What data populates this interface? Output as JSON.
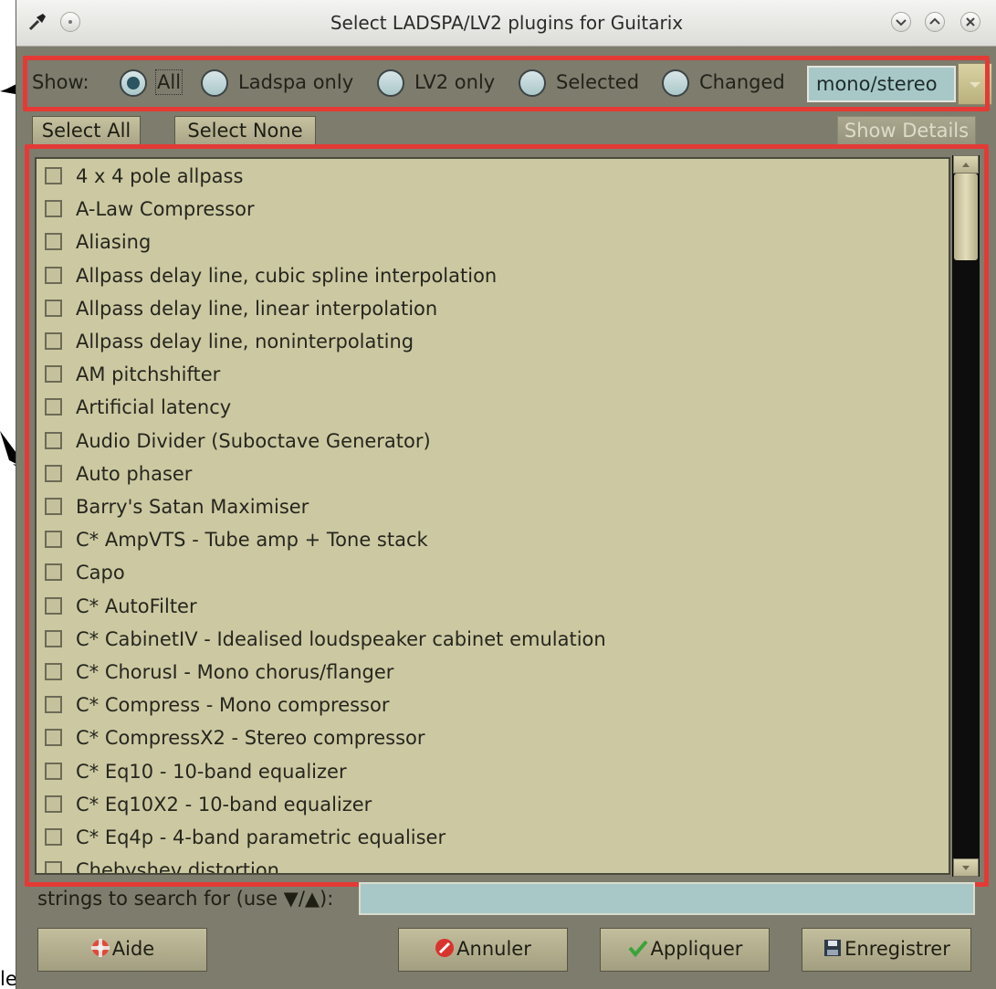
{
  "window": {
    "title": "Select LADSPA/LV2 plugins for Guitarix"
  },
  "show": {
    "label": "Show:",
    "options": [
      {
        "label": "All",
        "checked": true
      },
      {
        "label": "Ladspa only",
        "checked": false
      },
      {
        "label": "LV2 only",
        "checked": false
      },
      {
        "label": "Selected",
        "checked": false
      },
      {
        "label": "Changed",
        "checked": false
      }
    ],
    "channel_combo_value": "mono/stereo"
  },
  "buttons": {
    "select_all": "Select All",
    "select_none": "Select None",
    "show_details": "Show Details"
  },
  "plugins": [
    "4 x 4 pole allpass",
    "A-Law Compressor",
    "Aliasing",
    "Allpass delay line, cubic spline interpolation",
    "Allpass delay line, linear interpolation",
    "Allpass delay line, noninterpolating",
    "AM pitchshifter",
    "Artificial latency",
    "Audio Divider (Suboctave Generator)",
    "Auto phaser",
    "Barry's Satan Maximiser",
    "C* AmpVTS - Tube amp + Tone stack",
    "Capo",
    "C* AutoFilter",
    "C* CabinetIV - Idealised loudspeaker cabinet emulation",
    "C* ChorusI - Mono chorus/flanger",
    "C* Compress - Mono compressor",
    "C* CompressX2 - Stereo compressor",
    "C* Eq10 - 10-band equalizer",
    "C* Eq10X2 - 10-band equalizer",
    "C* Eq4p - 4-band parametric equaliser",
    "Chebyshev distortion"
  ],
  "search": {
    "label": "strings to search for (use ▼/▲):",
    "value": ""
  },
  "footer": {
    "help": "Aide",
    "cancel": "Annuler",
    "apply": "Appliquer",
    "save": "Enregistrer"
  },
  "colors": {
    "highlight_box": "#e43a36",
    "list_background": "#ccc9a2",
    "window_background": "#7e7c6d"
  }
}
